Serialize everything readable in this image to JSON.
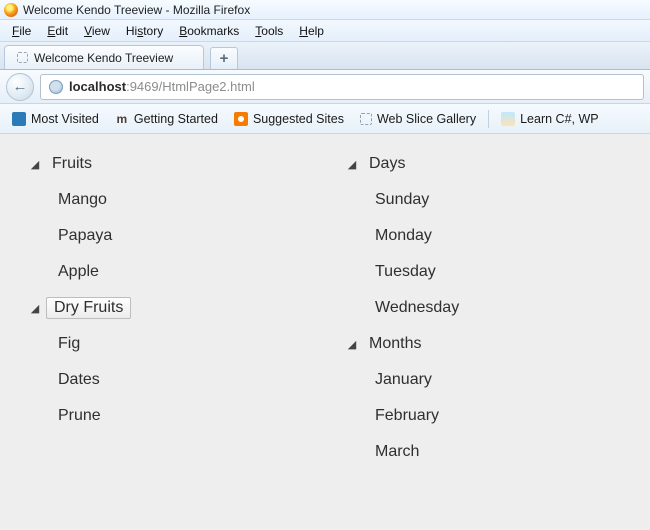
{
  "window": {
    "title": "Welcome Kendo Treeview - Mozilla Firefox"
  },
  "menus": {
    "file": "File",
    "edit": "Edit",
    "view": "View",
    "history": "History",
    "bookmarks": "Bookmarks",
    "tools": "Tools",
    "help": "Help"
  },
  "tabs": {
    "active": "Welcome Kendo Treeview",
    "newtab": "+"
  },
  "navbar": {
    "back": "←",
    "url_prefix": "localhost",
    "url_rest": ":9469/HtmlPage2.html"
  },
  "bookmarks": {
    "most_visited": "Most Visited",
    "getting_started": "Getting Started",
    "suggested": "Suggested Sites",
    "web_slice": "Web Slice Gallery",
    "learn_cs": "Learn C#, WP"
  },
  "tree": {
    "left": {
      "fruits": {
        "label": "Fruits",
        "children": {
          "mango": "Mango",
          "papaya": "Papaya",
          "apple": "Apple"
        }
      },
      "dryfruits": {
        "label": "Dry Fruits",
        "selected": "true",
        "children": {
          "fig": "Fig",
          "dates": "Dates",
          "prune": "Prune"
        }
      }
    },
    "right": {
      "days": {
        "label": "Days",
        "children": {
          "sunday": "Sunday",
          "monday": "Monday",
          "tuesday": "Tuesday",
          "wednesday": "Wednesday"
        }
      },
      "months": {
        "label": "Months",
        "children": {
          "january": "January",
          "february": "February",
          "march": "March"
        }
      }
    }
  }
}
